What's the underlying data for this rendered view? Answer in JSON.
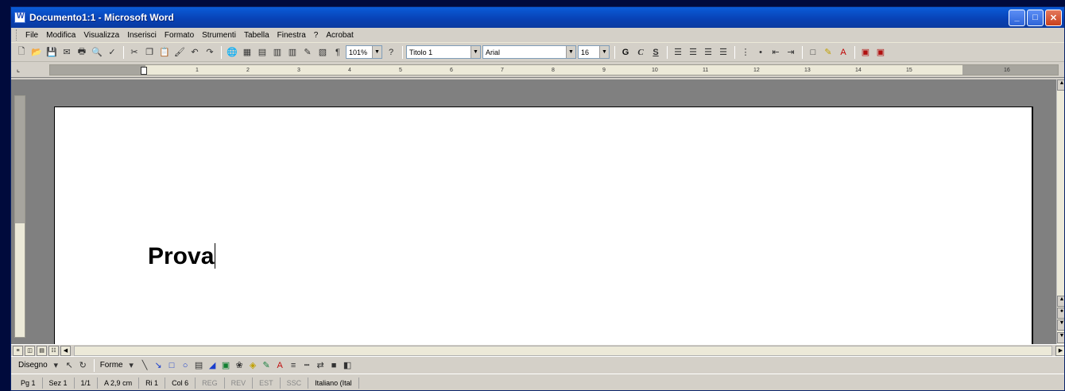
{
  "window": {
    "title": "Documento1:1 - Microsoft Word",
    "minimize_label": "_",
    "maximize_label": "□",
    "close_label": "✕"
  },
  "menubar": {
    "items": [
      "File",
      "Modifica",
      "Visualizza",
      "Inserisci",
      "Formato",
      "Strumenti",
      "Tabella",
      "Finestra",
      "?",
      "Acrobat"
    ]
  },
  "toolbar": {
    "zoom": "101%",
    "style": "Titolo 1",
    "font": "Arial",
    "size": "16",
    "bold_label": "G",
    "italic_label": "C",
    "underline_label": "S"
  },
  "ruler": {
    "ticks": [
      "1",
      "2",
      "3",
      "4",
      "5",
      "6",
      "7",
      "8",
      "9",
      "10",
      "11",
      "12",
      "13",
      "14",
      "15",
      "16"
    ]
  },
  "document": {
    "text": "Prova"
  },
  "drawing_toolbar": {
    "draw_label": "Disegno",
    "shapes_label": "Forme"
  },
  "statusbar": {
    "page": "Pg 1",
    "section": "Sez 1",
    "page_count": "1/1",
    "position": "A 2,9 cm",
    "line": "Ri 1",
    "column": "Col 6",
    "flags": [
      "REG",
      "REV",
      "EST",
      "SSC"
    ],
    "language": "Italiano (Ital"
  },
  "colors": {
    "titlebar": "#0a49c4",
    "chrome": "#d4d0c8",
    "desktop": "#000a3c",
    "workspace": "#808080"
  }
}
